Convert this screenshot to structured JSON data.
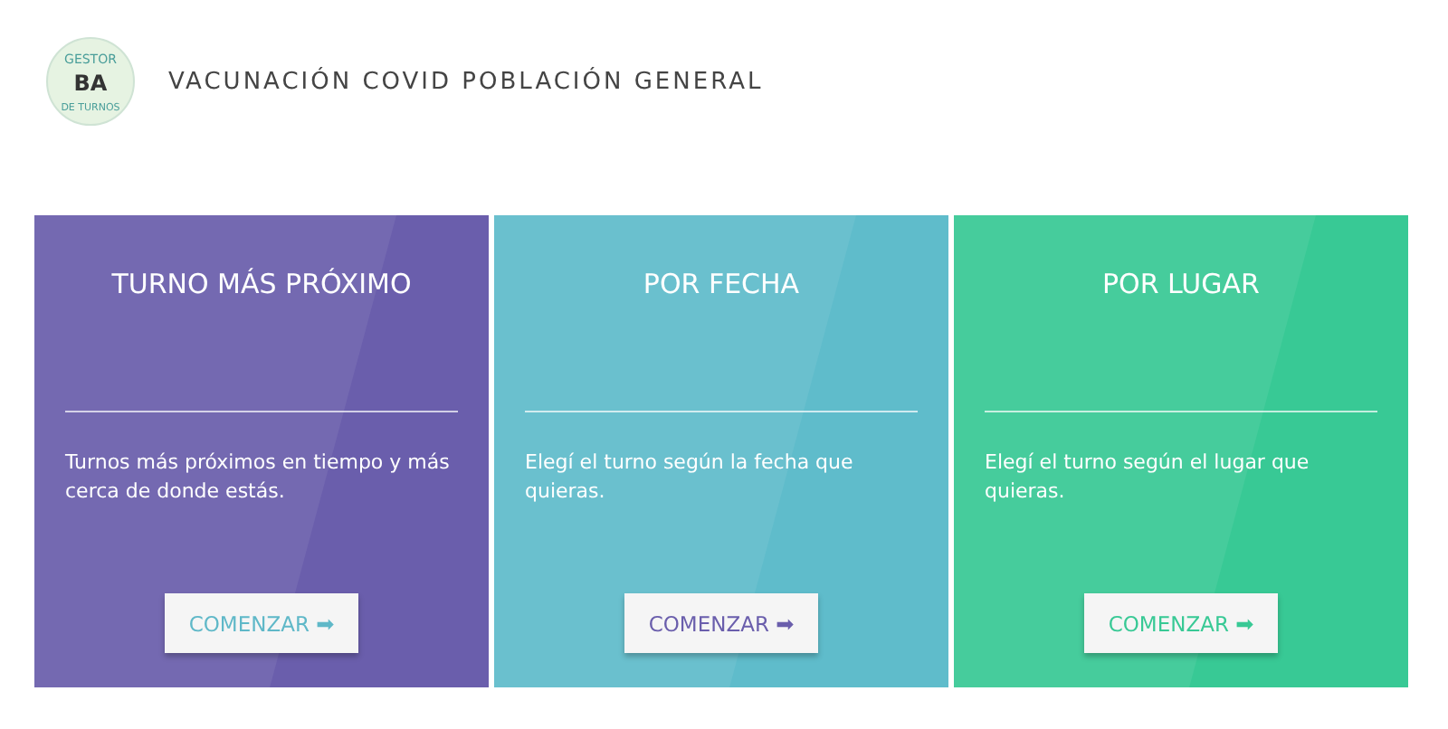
{
  "logo": {
    "top_text": "GESTOR",
    "mark": "BA",
    "bottom_text": "DE TURNOS"
  },
  "title": "VACUNACIÓN COVID POBLACIÓN GENERAL",
  "cards": [
    {
      "title": "TURNO MÁS PRÓXIMO",
      "description": "Turnos más próximos en tiempo y más cerca de donde estás.",
      "button": {
        "label": "COMENZAR",
        "arrow": "➡",
        "color": "#5fb8c8"
      },
      "color": "#6a5eac"
    },
    {
      "title": "POR FECHA",
      "description": "Elegí el turno según la fecha que quieras.",
      "button": {
        "label": "COMENZAR",
        "arrow": "➡",
        "color": "#6a5eac"
      },
      "color": "#5fbccb"
    },
    {
      "title": "POR LUGAR",
      "description": "Elegí el turno según el lugar que quieras.",
      "button": {
        "label": "COMENZAR",
        "arrow": "➡",
        "color": "#38c995"
      },
      "color": "#38c995"
    }
  ]
}
